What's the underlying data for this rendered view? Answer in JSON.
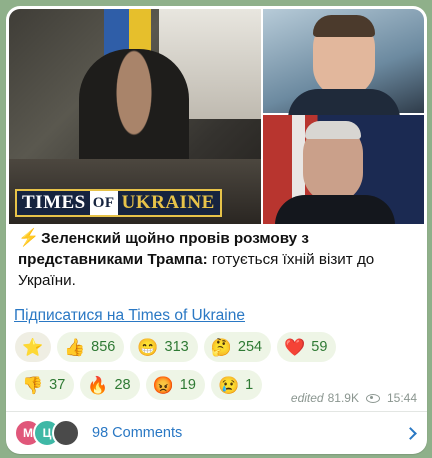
{
  "post": {
    "brand": {
      "part1": "TIMES",
      "part2": "OF",
      "part3": "UKRAINE"
    },
    "text_bold": "Зеленский щойно провів розмову з представниками Трампа:",
    "text_rest": " готується їхній візит до України.",
    "link": "Підписатися на Times of Ukraine"
  },
  "reactions_row1": [
    {
      "emoji": "⭐",
      "count": ""
    },
    {
      "emoji": "👍",
      "count": "856"
    },
    {
      "emoji": "😁",
      "count": "313"
    },
    {
      "emoji": "🤔",
      "count": "254"
    },
    {
      "emoji": "❤️",
      "count": "59"
    }
  ],
  "reactions_row2": [
    {
      "emoji": "👎",
      "count": "37"
    },
    {
      "emoji": "🔥",
      "count": "28"
    },
    {
      "emoji": "😡",
      "count": "19"
    },
    {
      "emoji": "😢",
      "count": "1"
    }
  ],
  "meta": {
    "edited": "edited",
    "views": "81.9K",
    "time": "15:44"
  },
  "comments": {
    "avatars": [
      "М",
      "Ц",
      ""
    ],
    "label": "98 Comments"
  },
  "colors": {
    "link": "#2a78c4",
    "reaction_bg": "#eef5e6",
    "reaction_text": "#2f7a34",
    "background": "#8fb08a"
  },
  "icons": {
    "lightning": "⚡",
    "views": "eye-icon",
    "chevron": "chevron-right-icon"
  }
}
